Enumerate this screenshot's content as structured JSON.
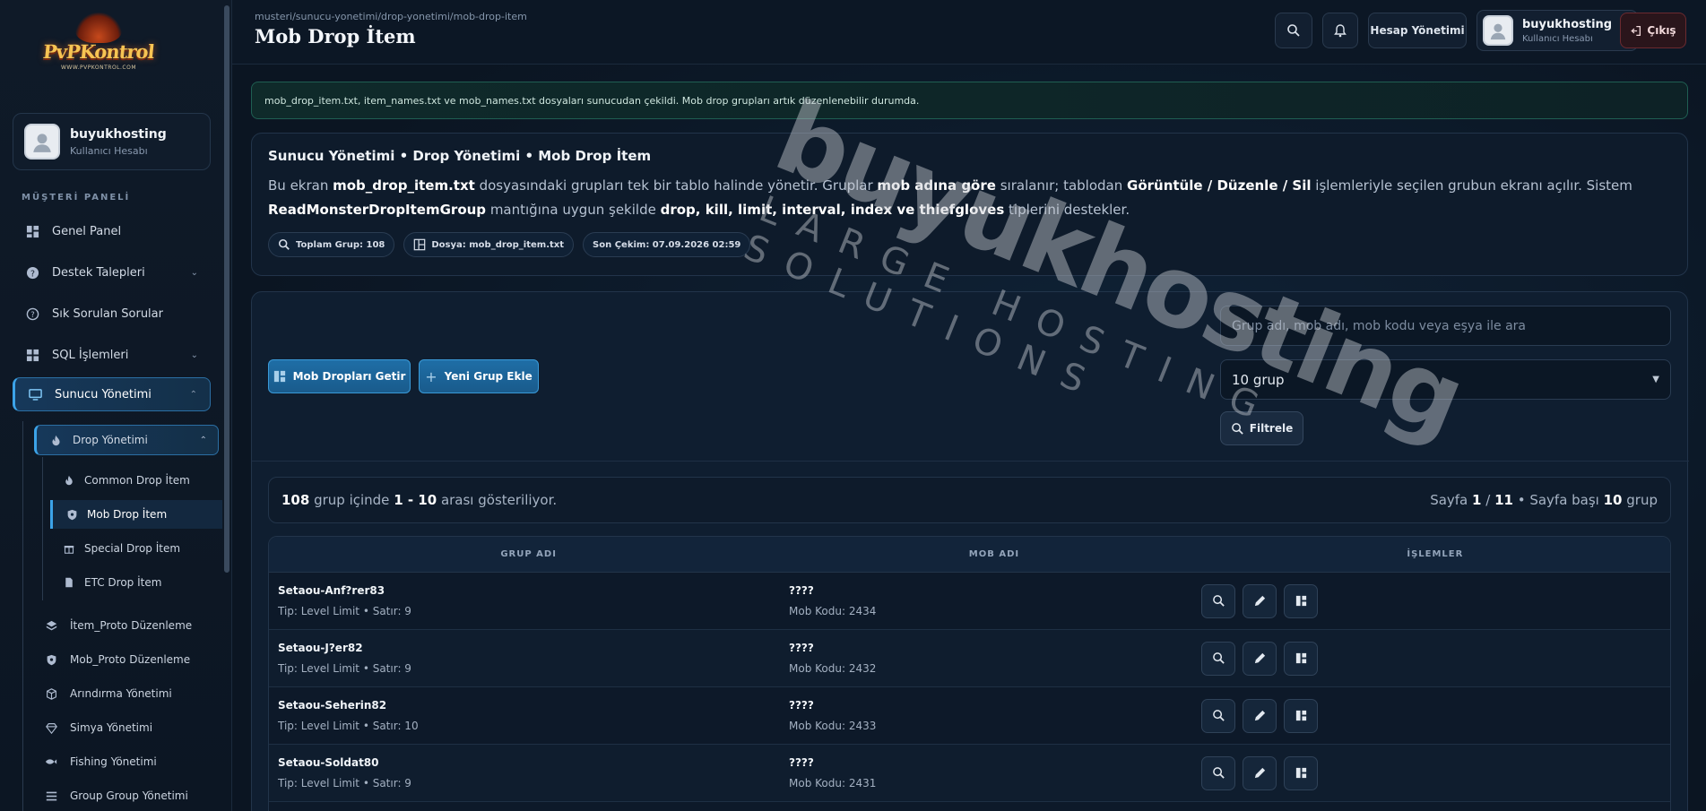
{
  "colors": {
    "accent": "#3ca3e8",
    "bg": "#0b1522",
    "success_border": "#1f5e52",
    "danger_border": "#6b2a30"
  },
  "logo": {
    "text": "PvPKontrol",
    "sub": "WWW.PVPKONTROL.COM"
  },
  "sidebar": {
    "user": {
      "name": "buyukhosting",
      "subtitle": "Kullanıcı Hesabı"
    },
    "section_title": "MÜŞTERİ PANELİ",
    "items": [
      {
        "label": "Genel Panel",
        "icon": "grid-icon"
      },
      {
        "label": "Destek Talepleri",
        "icon": "help-circle-icon"
      },
      {
        "label": "Sık Sorulan Sorular",
        "icon": "question-icon"
      },
      {
        "label": "SQL İşlemleri",
        "icon": "grid-icon"
      },
      {
        "label": "Sunucu Yönetimi",
        "icon": "monitor-icon"
      }
    ],
    "drop": {
      "label": "Drop Yönetimi",
      "icon": "flame-icon"
    },
    "drop_children": [
      {
        "label": "Common Drop İtem",
        "icon": "flame-icon"
      },
      {
        "label": "Mob Drop İtem",
        "icon": "shield-icon"
      },
      {
        "label": "Special Drop İtem",
        "icon": "gift-icon"
      },
      {
        "label": "ETC Drop İtem",
        "icon": "file-icon"
      }
    ],
    "lower": [
      {
        "label": "İtem_Proto Düzenleme",
        "icon": "layers-icon"
      },
      {
        "label": "Mob_Proto Düzenleme",
        "icon": "shield-icon"
      },
      {
        "label": "Arındırma Yönetimi",
        "icon": "cube-icon"
      },
      {
        "label": "Simya Yönetimi",
        "icon": "diamond-icon"
      },
      {
        "label": "Fishing Yönetimi",
        "icon": "fish-icon"
      },
      {
        "label": "Group Group Yönetimi",
        "icon": "list-icon"
      }
    ]
  },
  "header": {
    "breadcrumb": "musteri/sunucu-yonetimi/drop-yonetimi/mob-drop-item",
    "title": "Mob Drop İtem",
    "account_button": "Hesap Yönetimi",
    "user": {
      "name": "buyukhosting",
      "subtitle": "Kullanıcı Hesabı"
    },
    "logout": "Çıkış"
  },
  "alert": "mob_drop_item.txt, item_names.txt ve mob_names.txt dosyaları sunucudan çekildi. Mob drop grupları artık düzenlenebilir durumda.",
  "info": {
    "title": "Sunucu Yönetimi • Drop Yönetimi • Mob Drop İtem",
    "desc": {
      "p1": "Bu ekran ",
      "b1": "mob_drop_item.txt",
      "p2": " dosyasındaki grupları tek bir tablo halinde yönetir. Gruplar ",
      "b2": "mob adına göre",
      "p3": " sıralanır; tablodan ",
      "b3": "Görüntüle / Düzenle / Sil",
      "p4": " işlemleriyle seçilen grubun ekranı açılır. Sistem ",
      "b4": "ReadMonsterDropItemGroup",
      "p5": " mantığına uygun şekilde ",
      "b5": "drop, kill, limit, interval, index ve thiefgloves",
      "p6": " tiplerini destekler."
    },
    "chips": {
      "total": "Toplam Grup: 108",
      "file": "Dosya: mob_drop_item.txt",
      "last": "Son Çekim: 07.09.2026 02:59"
    }
  },
  "toolbar": {
    "fetch_button": "Mob Dropları Getir",
    "add_button": "Yeni Grup Ekle",
    "search_placeholder": "Grup adı, mob adı, mob kodu veya eşya ile ara",
    "per_page": "10 grup",
    "filter_button": "Filtrele"
  },
  "summary": {
    "total": "108",
    "mid1": " grup içinde ",
    "range": "1 - 10",
    "mid2": " arası gösteriliyor.",
    "page_label": "Sayfa ",
    "page": "1",
    "sep": " / ",
    "pages": "11",
    "per_label": " • Sayfa başı ",
    "per": "10",
    "per_unit": " grup"
  },
  "table": {
    "headers": [
      "GRUP ADI",
      "MOB ADI",
      "İŞLEMLER"
    ],
    "rows": [
      {
        "group": "Setaou-Anf?rer83",
        "meta": "Tip: Level Limit • Satır: 9",
        "mob": "????",
        "code": "Mob Kodu: 2434"
      },
      {
        "group": "Setaou-J?er82",
        "meta": "Tip: Level Limit • Satır: 9",
        "mob": "????",
        "code": "Mob Kodu: 2432"
      },
      {
        "group": "Setaou-Seherin82",
        "meta": "Tip: Level Limit • Satır: 10",
        "mob": "????",
        "code": "Mob Kodu: 2433"
      },
      {
        "group": "Setaou-Soldat80",
        "meta": "Tip: Level Limit • Satır: 9",
        "mob": "????",
        "code": "Mob Kodu: 2431"
      }
    ]
  },
  "watermark": {
    "main": "buyukhosting",
    "sub": "LARGE HOSTING SOLUTIONS"
  }
}
